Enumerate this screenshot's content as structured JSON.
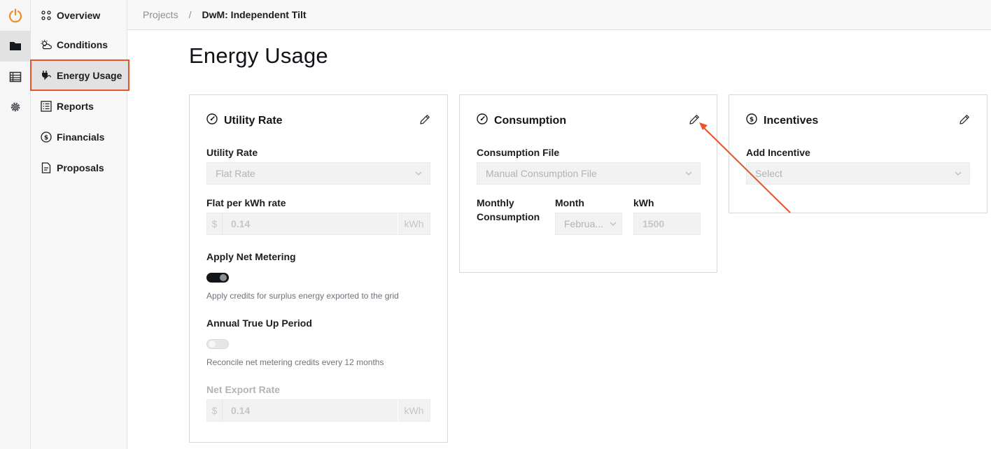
{
  "breadcrumb": {
    "parent": "Projects",
    "separator": "/",
    "current": "DwM: Independent Tilt"
  },
  "nav": {
    "items": [
      {
        "label": "Overview",
        "icon": "dots-grid-icon"
      },
      {
        "label": "Conditions",
        "icon": "sun-cloud-icon"
      },
      {
        "label": "Energy Usage",
        "icon": "plug-icon",
        "active": true
      },
      {
        "label": "Reports",
        "icon": "report-list-icon"
      },
      {
        "label": "Financials",
        "icon": "dollar-circle-icon"
      },
      {
        "label": "Proposals",
        "icon": "document-icon"
      }
    ]
  },
  "rail": {
    "icons": [
      "power-logo-icon",
      "folder-icon",
      "table-icon",
      "gear-icon"
    ]
  },
  "page": {
    "title": "Energy Usage"
  },
  "utility_rate": {
    "title": "Utility Rate",
    "rate_label": "Utility Rate",
    "rate_value": "Flat Rate",
    "flat_label": "Flat per kWh rate",
    "flat_prefix": "$",
    "flat_value": "0.14",
    "flat_suffix": "kWh",
    "net_metering_label": "Apply Net Metering",
    "net_metering_on": true,
    "net_metering_help": "Apply credits for surplus energy exported to the grid",
    "true_up_label": "Annual True Up Period",
    "true_up_on": false,
    "true_up_help": "Reconcile net metering credits every 12 months",
    "export_label": "Net Export Rate",
    "export_prefix": "$",
    "export_value": "0.14",
    "export_suffix": "kWh"
  },
  "consumption": {
    "title": "Consumption",
    "file_label": "Consumption File",
    "file_value": "Manual Consumption File",
    "monthly_label_1": "Monthly",
    "monthly_label_2": "Consumption",
    "month_label": "Month",
    "month_value": "Februa...",
    "kwh_label": "kWh",
    "kwh_value": "1500"
  },
  "incentives": {
    "title": "Incentives",
    "add_label": "Add Incentive",
    "add_placeholder": "Select"
  },
  "colors": {
    "accent": "#e8542a",
    "toggle_on": "#12151a"
  }
}
